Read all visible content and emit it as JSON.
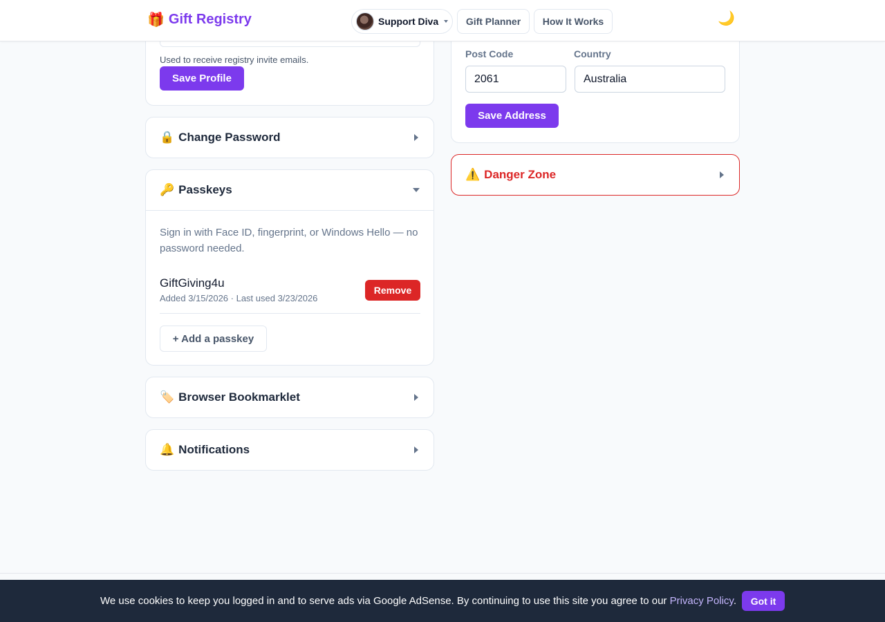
{
  "header": {
    "brand_icon": "gift-icon",
    "brand": "Gift Registry",
    "user_name": "Support Diva",
    "nav_planner": "Gift Planner",
    "nav_how": "How It Works",
    "theme_icon": "moon-icon"
  },
  "profile": {
    "help_text": "Used to receive registry invite emails.",
    "save_label": "Save Profile"
  },
  "address": {
    "postcode_label": "Post Code",
    "postcode_value": "2061",
    "country_label": "Country",
    "country_value": "Australia",
    "save_label": "Save Address"
  },
  "sections": {
    "change_password": {
      "icon": "🔒",
      "title": "Change Password"
    },
    "passkeys": {
      "icon": "🔑",
      "title": "Passkeys"
    },
    "bookmarklet": {
      "icon": "🏷️",
      "title": "Browser Bookmarklet"
    },
    "notifications": {
      "icon": "🔔",
      "title": "Notifications"
    },
    "danger": {
      "icon": "⚠️",
      "title": "Danger Zone"
    }
  },
  "passkeys": {
    "description": "Sign in with Face ID, fingerprint, or Windows Hello — no password needed.",
    "items": [
      {
        "name": "GiftGiving4u",
        "meta": "Added 3/15/2026 · Last used 3/23/2026",
        "remove_label": "Remove"
      }
    ],
    "add_label": "+ Add a passkey"
  },
  "cookie": {
    "text": "We use cookies to keep you logged in and to serve ads via Google AdSense. By continuing to use this site you agree to our ",
    "link": "Privacy Policy",
    "suffix": ".",
    "button": "Got it"
  },
  "colors": {
    "accent": "#7c3aed",
    "danger": "#dc2626",
    "banner": "#1e293b"
  }
}
